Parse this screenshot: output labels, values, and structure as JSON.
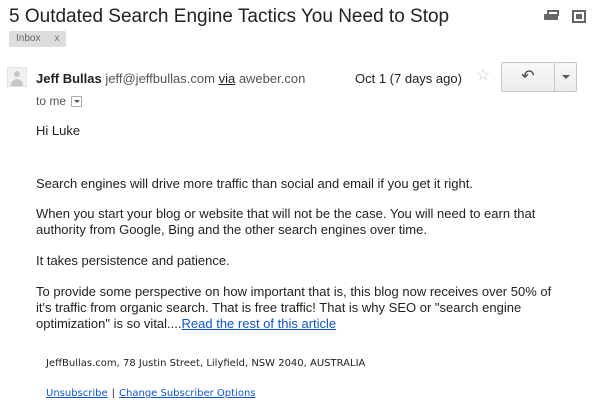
{
  "email": {
    "subject": "5 Outdated Search Engine Tactics You Need to Stop",
    "label": {
      "name": "Inbox",
      "remove": "x"
    },
    "sender": {
      "name": "Jeff Bullas",
      "email": "jeff@jeffbullas.com",
      "via_label": "via",
      "via_domain": "aweber.con"
    },
    "date": "Oct 1 (7 days ago)",
    "to": "to me",
    "icons": {
      "print": "print-icon",
      "new_window": "new-window-icon",
      "star": "star-icon",
      "reply": "reply-icon",
      "more": "chevron-down-icon"
    },
    "body": {
      "greeting": "Hi Luke",
      "p1": "Search engines will drive more traffic than social and email if you get it right.",
      "p2": "When you start your blog or website that will not be the case. You will need to earn that authority from Google, Bing and the other search engines over time.",
      "p3": "It takes persistence and patience.",
      "p4": "To provide some perspective on how important that is, this blog now receives over 50% of it's traffic from organic search. That is free traffic! That is why SEO or \"search engine optimization\" is so vital....",
      "p4_link": "Read the rest of this article"
    },
    "footer": {
      "address": "JeffBullas.com, 78 Justin Street, Lilyfield, NSW 2040, AUSTRALIA",
      "unsubscribe": "Unsubscribe",
      "separator": "|",
      "change_options": "Change Subscriber Options"
    },
    "colors": {
      "link": "#1155cc",
      "text": "#222222",
      "chip_bg": "#dddddd"
    }
  }
}
